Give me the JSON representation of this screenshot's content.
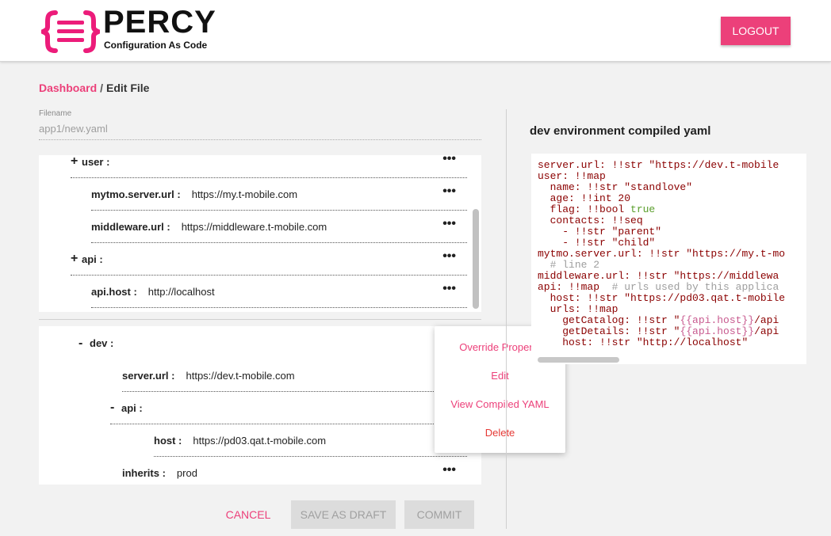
{
  "header": {
    "logo_title": "PERCY",
    "logo_subtitle": "Configuration As Code",
    "logout_label": "LOGOUT",
    "accent": "#ec407a"
  },
  "breadcrumb": {
    "link": "Dashboard",
    "separator": "/",
    "current": "Edit File"
  },
  "filename": {
    "label": "Filename",
    "value": "app1/new.yaml"
  },
  "tree_top": [
    {
      "toggle": "+",
      "key": "user :",
      "value": "",
      "more": "•••"
    },
    {
      "toggle": "",
      "key": "mytmo.server.url :",
      "value": "https://my.t-mobile.com",
      "more": "•••"
    },
    {
      "toggle": "",
      "key": "middleware.url :",
      "value": "https://middleware.t-mobile.com",
      "more": "•••"
    },
    {
      "toggle": "+",
      "key": "api :",
      "value": "",
      "more": "•••"
    },
    {
      "toggle": "",
      "key": "api.host :",
      "value": "http://localhost",
      "more": "•••"
    }
  ],
  "tree_bottom": [
    {
      "toggle": "-",
      "key": "dev :",
      "value": "",
      "more": ""
    },
    {
      "toggle": "",
      "key": "server.url :",
      "value": "https://dev.t-mobile.com",
      "more": ""
    },
    {
      "toggle": "-",
      "key": "api :",
      "value": "",
      "more": ""
    },
    {
      "toggle": "",
      "key": "host :",
      "value": "https://pd03.qat.t-mobile.com",
      "more": ""
    },
    {
      "toggle": "",
      "key": "inherits :",
      "value": "prod",
      "more": "•••"
    }
  ],
  "context_menu": {
    "items": [
      "Override Property",
      "Edit",
      "View Compiled YAML",
      "Delete"
    ]
  },
  "actions": {
    "cancel": "CANCEL",
    "save_draft": "SAVE AS DRAFT",
    "commit": "COMMIT"
  },
  "yaml_panel": {
    "title": "dev environment compiled yaml",
    "lines": [
      "server.url: !!str \"https://dev.t-mobile",
      "user: !!map",
      "  name: !!str \"standlove\"",
      "  age: !!int 20",
      "  flag: !!bool true",
      "  contacts: !!seq",
      "    - !!str \"parent\"",
      "    - !!str \"child\"",
      "mytmo.server.url: !!str \"https://my.t-mo",
      "  # line 2",
      "middleware.url: !!str \"https://middlewa",
      "api: !!map  # urls used by this applica",
      "  host: !!str \"https://pd03.qat.t-mobile",
      "  urls: !!map",
      "    getCatalog: !!str \"{{api.host}}/api",
      "    getDetails: !!str \"{{api.host}}/api",
      "    host: !!str \"http://localhost\""
    ]
  }
}
